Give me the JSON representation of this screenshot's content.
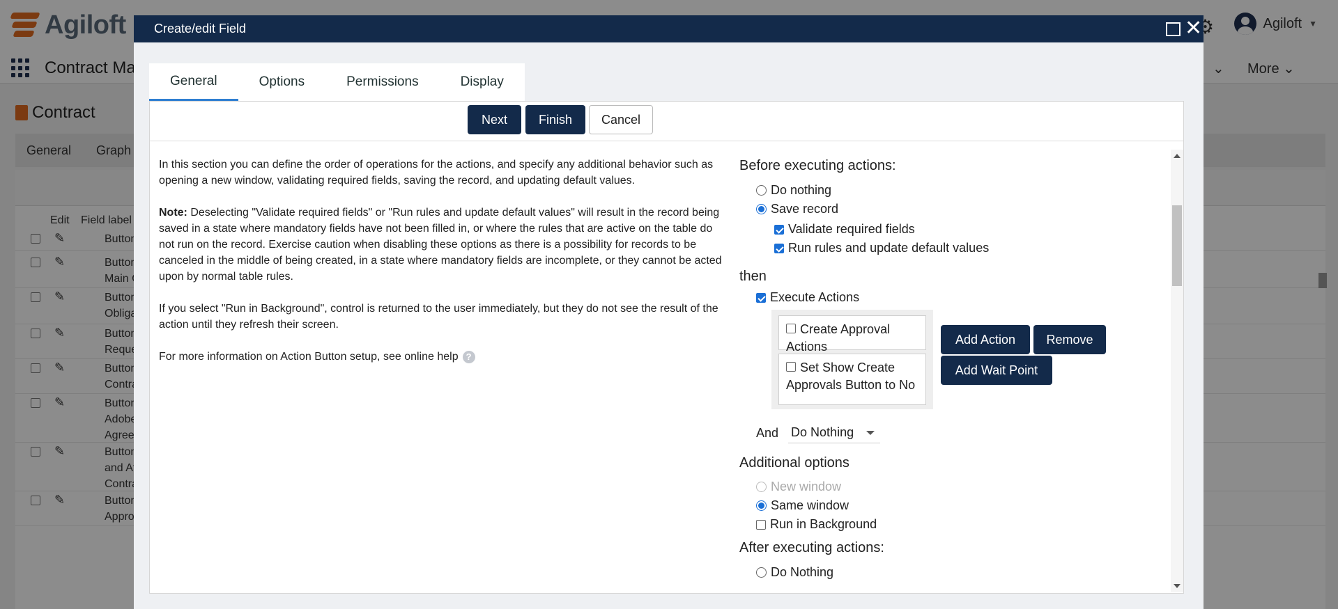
{
  "app": {
    "logo_text": "Agiloft",
    "user_name": "Agiloft",
    "app_title": "Contract Ma",
    "nav_more": "More",
    "page_title": "Contract",
    "sub_tabs": [
      "General",
      "Graph"
    ],
    "table_headers": {
      "edit": "Edit",
      "field_label": "Field label"
    },
    "rows": [
      {
        "label": "Button: Ac"
      },
      {
        "label": "Button: Ac\nMain Cont"
      },
      {
        "label": "Button: Ac\nObligation"
      },
      {
        "label": "Button: Ac\nRequester"
      },
      {
        "label": "Button: Ca\nContract"
      },
      {
        "label": "Button: Cr\nAdobe Sig\nAgreemen"
      },
      {
        "label": "Button: Cr\nand Attach\nContract"
      },
      {
        "label": "Button: Cr\nApprovals"
      }
    ]
  },
  "dialog": {
    "title": "Create/edit Field",
    "tabs": [
      "General",
      "Options",
      "Permissions",
      "Display"
    ],
    "buttons": {
      "next": "Next",
      "finish": "Finish",
      "cancel": "Cancel"
    },
    "intro": "In this section you can define the order of operations for the actions, and specify any additional behavior such as opening a new window, validating required fields, saving the record, and updating default values.",
    "note_label": "Note:",
    "note_text": " Deselecting \"Validate required fields\" or \"Run rules and update default values\" will result in the record being saved in a state where mandatory fields have not been filled in, or where the rules that are active on the table do not run on the record. Exercise caution when disabling these options as there is a possibility for records to be canceled in the middle of being created, in a state where mandatory fields are incomplete, or they cannot be acted upon by normal table rules.",
    "background_text": "If you select \"Run in Background\", control is returned to the user immediately, but they do not see the result of the action until they refresh their screen.",
    "help_text": "For more information on Action Button setup, see online help",
    "before_heading": "Before executing actions:",
    "before_options": {
      "do_nothing": "Do nothing",
      "save_record": "Save record"
    },
    "validate_required": "Validate required fields",
    "run_rules": "Run rules and update default values",
    "then_heading": "then",
    "execute_actions": "Execute Actions",
    "actions": [
      "Create Approval Actions",
      "Set Show Create Approvals Button to No"
    ],
    "action_buttons": {
      "add_action": "Add Action",
      "remove": "Remove",
      "add_wait_point": "Add Wait Point"
    },
    "and_label": "And",
    "and_value": "Do Nothing",
    "additional_heading": "Additional options",
    "additional_options": {
      "new_window": "New window",
      "same_window": "Same window",
      "run_background": "Run in Background"
    },
    "after_heading": "After executing actions:",
    "after_options": {
      "do_nothing": "Do Nothing"
    }
  },
  "colors": {
    "header": "#132a4a",
    "accent": "#2f7fd1",
    "radio": "#1a6fd6",
    "brand_orange": "#e06b1f"
  }
}
